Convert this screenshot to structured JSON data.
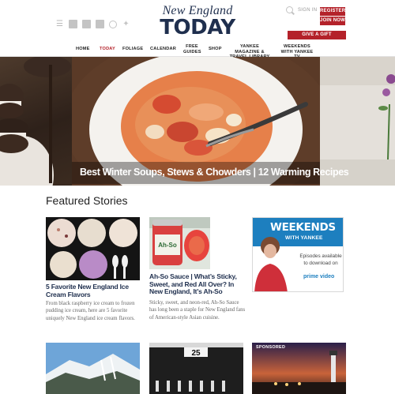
{
  "header": {
    "logo_line1": "New England",
    "logo_line2": "TODAY",
    "sign_in": "SIGN IN",
    "register": "REGISTER",
    "join_now": "JOIN NOW",
    "give_gift": "GIVE A GIFT",
    "social_icons": [
      "menu-icon",
      "facebook-icon",
      "google-plus-icon",
      "instagram-icon",
      "pinterest-icon",
      "twitter-icon"
    ]
  },
  "nav": {
    "items": [
      {
        "label": "HOME",
        "active": false
      },
      {
        "label": "TODAY",
        "active": true
      },
      {
        "label": "FOLIAGE",
        "active": false
      },
      {
        "label": "CALENDAR",
        "active": false
      },
      {
        "label": "FREE GUIDES",
        "active": false
      },
      {
        "label": "SHOP",
        "active": false
      },
      {
        "label": "YANKEE MAGAZINE & TRAVEL LIBRARY",
        "active": false
      },
      {
        "label": "WEEKENDS WITH YANKEE TV",
        "active": false
      }
    ]
  },
  "hero": {
    "caption": "Best Winter Soups, Stews & Chowders | 12 Warming Recipes"
  },
  "featured": {
    "title": "Featured Stories",
    "cards": [
      {
        "title": "5 Favorite New England Ice Cream Flavors",
        "desc": "From black raspberry ice cream to frozen pudding ice cream, here are 5 favorite uniquely New England ice cream flavors."
      },
      {
        "title": "Ah-So Sauce | What’s Sticky, Sweet, and Red All Over? In New England, It’s Ah-So",
        "desc": "Sticky, sweet, and neon-red, Ah-So Sauce has long been a staple for New England fans of American-style Asian cuisine."
      }
    ],
    "ah_so_label": "Ah-So"
  },
  "ad": {
    "title": "WEEKENDS",
    "subtitle": "WITH YANKEE",
    "body": "Episodes available to download on",
    "brand": "prime video"
  },
  "bottom": {
    "sponsored": "SPONSORED",
    "sign_number": "25"
  },
  "colors": {
    "brand_navy": "#1f2f4e",
    "brand_red": "#b4222a",
    "ad_blue": "#1d7fbf"
  }
}
